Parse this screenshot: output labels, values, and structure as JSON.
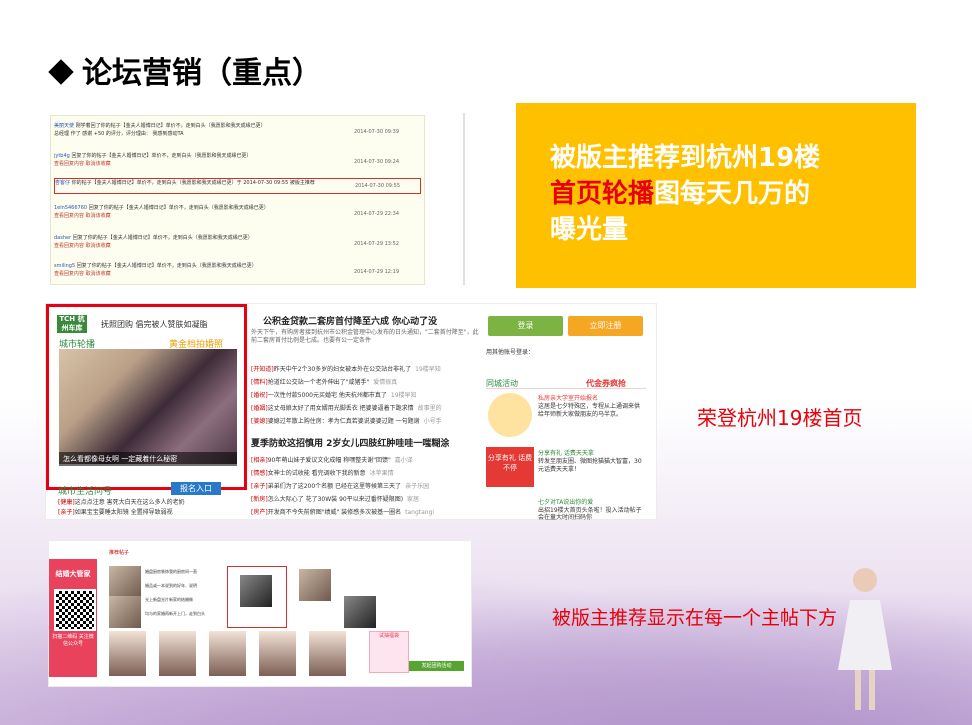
{
  "slide": {
    "title": "论坛营销（重点）"
  },
  "messages": [
    {
      "who": "美丽天使",
      "text": "刚学着回了你的帖子【金夫人婚博日记】单价不，走到白头（我愿影和我天成缘已更）",
      "extra": "总经理 作了 感谢 +50 的评分，评分理由： 我感到感动TA",
      "ts": "2014-07-30 09:39"
    },
    {
      "who": "jytb4g",
      "text": "回复了你的帖子【金夫人婚博日记】单价不，走到白头（我愿影和我天成缘已更）",
      "extra": "查看回复内容 取消该收藏",
      "ts": "2014-07-30 09:24"
    },
    {
      "who": "杏客仔",
      "text": "你的帖子【金夫人婚博日记】单价不，走到白头（我愿影和我天成缘已更）于 2014-07-30 09:55 被版主推荐",
      "extra": "",
      "ts": "2014-07-30 09:55"
    },
    {
      "who": "1eln5466760",
      "text": "回复了你的帖子【金夫人婚博日记】单价不，走到白头（我愿影和我天成缘已更）",
      "extra": "查看回复内容 取消该收藏",
      "ts": "2014-07-29 22:34"
    },
    {
      "who": "dasher",
      "text": "回复了你的帖子【金夫人婚博日记】单价不，走到白头（我愿影和我天成缘已更）",
      "extra": "查看回复内容 取消该收藏",
      "ts": "2014-07-29 13:52"
    },
    {
      "who": "smiling5",
      "text": "回复了你的帖子【金夫人婚博日记】单价不，走到白头（我愿影和我天成缘已更）",
      "extra": "查看回复内容 取消该收藏",
      "ts": "2014-07-29 12:19"
    }
  ],
  "callout": {
    "line1": "被版主推荐到杭州19楼",
    "line2_red": "首页轮播",
    "line2_rest": "图每天几万的",
    "line3": "曝光量"
  },
  "home": {
    "logo": "TCH 杭州车库",
    "carousel_title": "抚照团购 倡完被人赞肤如凝脂",
    "city_label": "城市轮播",
    "gold_label": "黄金档拍婚照",
    "caption": "怎么看都像母女啊 一定藏着什么秘密",
    "headline1": "公积金贷款二套房首付降至六成 你心动了没",
    "sub1": "外天下午，有购房者接到杭州市公积金管理中心发布的日头通知，\"二套首付降至\"，此前二套房首付比例是七成。也要有公一定条件",
    "news": [
      {
        "tag": "[开知道]",
        "text": "昨天中午2个30多岁的妇女被本外在公交站台非礼了",
        "src": "19楼早知"
      },
      {
        "tag": "[情料]",
        "text": "抢道红公交站一个老外伸出了\"咸猪手\"",
        "src": "爱情很真"
      },
      {
        "tag": "[婚祝]",
        "text": "一次性付款5000元买婚宅 他天杭州都市真了",
        "src": "19楼早知"
      },
      {
        "tag": "[婚姻]",
        "text": "这丈母娘太好了用女婿用光脚丢衣 把婆婆逼着下跪求情",
        "src": "故事里的"
      },
      {
        "tag": "[婆媳]",
        "text": "婆媳过年散上购住房：孝为仁真若婆说婆婆过题 一句题谢",
        "src": "小号手"
      }
    ],
    "headline2": "夏季防蚊这招慎用 2岁女儿四肢红肿哇哇一嗤糊涂",
    "news2": [
      {
        "tag": "[相亲]",
        "text": "90年萌山妹子爱议文化成幅 称嘿整夫谢\"回馈\"",
        "src": "嘉小译"
      },
      {
        "tag": "[情感]",
        "text": "女神士的试收能 看完调收下我的新意",
        "src": "冰苹果情"
      },
      {
        "tag": "[亲子]",
        "text": "弟弟们为了这200个名额 已经在这里等候第三天了",
        "src": "亲子乐园"
      },
      {
        "tag": "[新房]",
        "text": "怎么大际心了 花了30W装 90平以来过番怀疑限图)",
        "src": "家居"
      },
      {
        "tag": "[房产]",
        "text": "开发商不今失前俯图\"绩威\" 装修感多次被基一圈名",
        "src": "tangtangi"
      }
    ],
    "city_life": "城市生活问号",
    "baoming": "报名入口",
    "life": [
      {
        "tag": "[健康]",
        "text": "这点点注意 害死大白天在这么多人的老奶"
      },
      {
        "tag": "[亲子]",
        "text": "如果宝宝要睡太阳镜 全置排导致弱视"
      }
    ],
    "login": "登录",
    "register": "立即注册",
    "quick_login": "用其他账号登录：",
    "city_events": "同城活动",
    "gold_brand": "代金券疯抢",
    "event_text": "这居是七夕特殊区，专程从上通调来供给年师新大家做朋友的马半京。",
    "event_title": "私房亲大学室开始报名",
    "share_badge": "分享有礼 话费不停",
    "share_title": "分享有礼 话费天天拿",
    "share_text": "转发至朋友圈、微图抢猫猫大智富，30元话费天天拿！",
    "valentine": "七夕对TA说出你的爱",
    "valentine_text": "出招19楼大首页头条啦！投入活动帖子会在童大时间扫码你"
  },
  "callout2": "荣登杭州19楼首页",
  "callout3": "被版主推荐显示在每一个主帖下方",
  "post": {
    "tag_title": "结婚大管家",
    "tag_sub": "扫描二维码 关注微信公众号",
    "section": "推荐帖子",
    "items": [
      "婚盘厨房装饰我的厨房间一直",
      "婚品或一本说到的好年、说明",
      "光上新盘光片新家的结婚做",
      "均与的家婚再新开上门，走到白头"
    ],
    "gift": "试抽福袋",
    "btn": "发起团购活动"
  }
}
